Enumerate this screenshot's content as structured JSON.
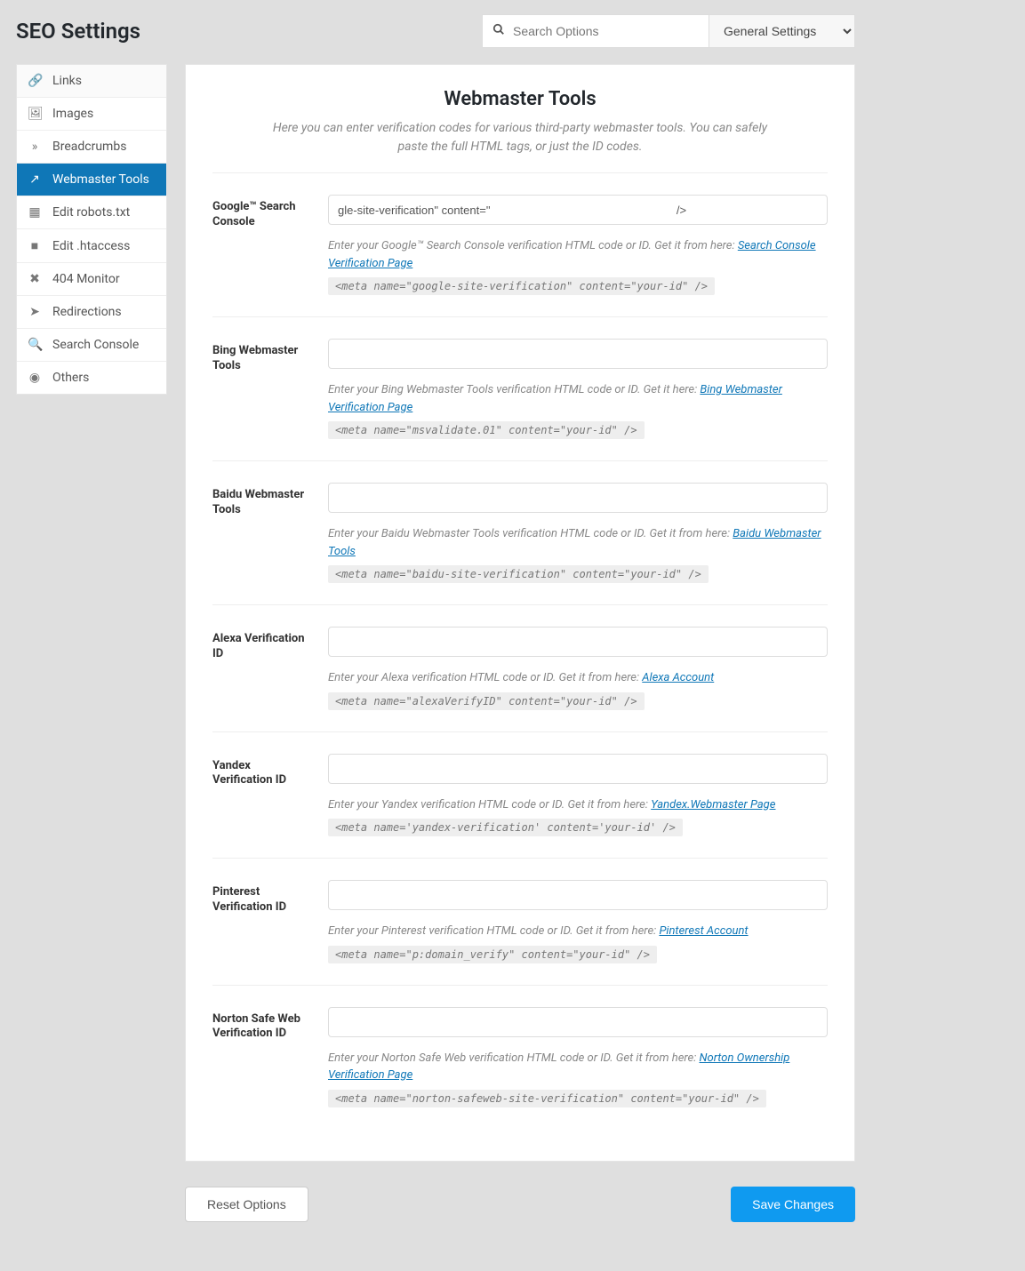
{
  "header": {
    "title": "SEO Settings",
    "search_placeholder": "Search Options",
    "scope": "General Settings"
  },
  "sidebar": {
    "items": [
      {
        "icon": "🔗",
        "label": "Links"
      },
      {
        "icon": "🖼",
        "label": "Images"
      },
      {
        "icon": "»",
        "label": "Breadcrumbs"
      },
      {
        "icon": "↗",
        "label": "Webmaster Tools"
      },
      {
        "icon": "▦",
        "label": "Edit robots.txt"
      },
      {
        "icon": "■",
        "label": "Edit .htaccess"
      },
      {
        "icon": "✖",
        "label": "404 Monitor"
      },
      {
        "icon": "➤",
        "label": "Redirections"
      },
      {
        "icon": "🔍",
        "label": "Search Console"
      },
      {
        "icon": "◉",
        "label": "Others"
      }
    ]
  },
  "section": {
    "title": "Webmaster Tools",
    "subtitle": "Here you can enter verification codes for various third-party webmaster tools. You can safely paste the full HTML tags, or just the ID codes."
  },
  "fields": {
    "google": {
      "label": "Google™ Search Console",
      "value": "gle-site-verification\" content=\"                                                          />",
      "help_pre": "Enter your Google™ Search Console verification HTML code or ID. Get it from here: ",
      "link": "Search Console Verification Page",
      "code": "<meta name=\"google-site-verification\" content=\"your-id\" />"
    },
    "bing": {
      "label": "Bing Webmaster Tools",
      "value": "",
      "help_pre": "Enter your Bing Webmaster Tools verification HTML code or ID. Get it here: ",
      "link": "Bing Webmaster Verification Page",
      "code": "<meta name=\"msvalidate.01\" content=\"your-id\" />"
    },
    "baidu": {
      "label": "Baidu Webmaster Tools",
      "value": "",
      "help_pre": "Enter your Baidu Webmaster Tools verification HTML code or ID. Get it from here: ",
      "link": "Baidu Webmaster Tools",
      "code": "<meta name=\"baidu-site-verification\" content=\"your-id\" />"
    },
    "alexa": {
      "label": "Alexa Verification ID",
      "value": "",
      "help_pre": "Enter your Alexa verification HTML code or ID. Get it from here: ",
      "link": "Alexa Account",
      "code": "<meta name=\"alexaVerifyID\" content=\"your-id\" />"
    },
    "yandex": {
      "label": "Yandex Verification ID",
      "value": "",
      "help_pre": "Enter your Yandex verification HTML code or ID. Get it from here: ",
      "link": "Yandex.Webmaster Page",
      "code": "<meta name='yandex-verification' content='your-id' />"
    },
    "pinterest": {
      "label": "Pinterest Verification ID",
      "value": "",
      "help_pre": "Enter your Pinterest verification HTML code or ID. Get it from here: ",
      "link": "Pinterest Account",
      "code": "<meta name=\"p:domain_verify\" content=\"your-id\" />"
    },
    "norton": {
      "label": "Norton Safe Web Verification ID",
      "value": "",
      "help_pre": "Enter your Norton Safe Web verification HTML code or ID. Get it from here: ",
      "link": "Norton Ownership Verification Page",
      "code": "<meta name=\"norton-safeweb-site-verification\" content=\"your-id\" />"
    }
  },
  "actions": {
    "reset": "Reset Options",
    "save": "Save Changes"
  }
}
